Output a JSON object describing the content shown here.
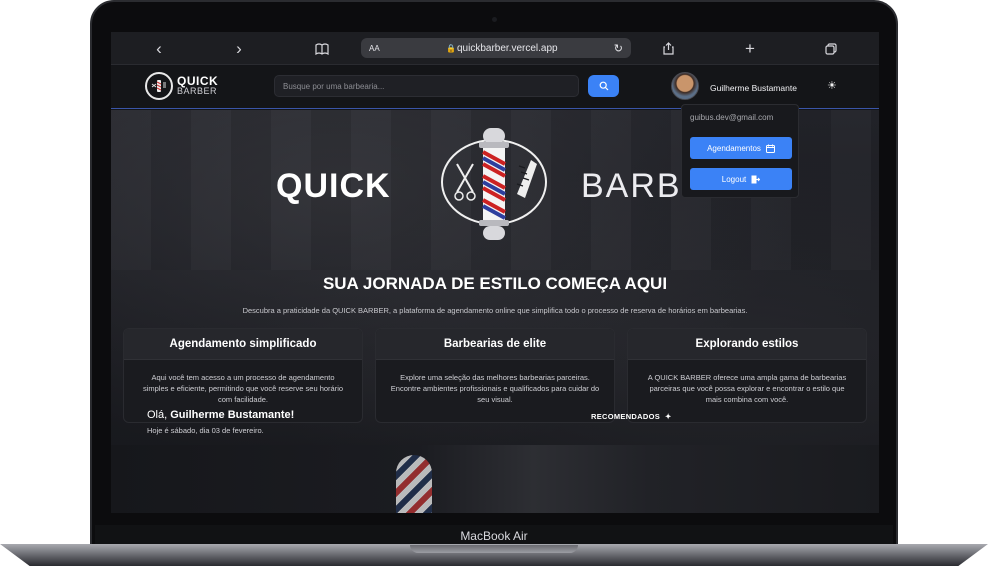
{
  "device": {
    "label": "MacBook Air"
  },
  "browser": {
    "url": "quickbarber.vercel.app",
    "text_size_label": "AA"
  },
  "header": {
    "logo": {
      "line1": "QUICK",
      "line2": "BARBER"
    },
    "search": {
      "placeholder": "Busque por uma barbearia..."
    },
    "user": {
      "name": "Guilherme Bustamante"
    }
  },
  "dropdown": {
    "email": "guibus.dev@gmail.com",
    "appointments_label": "Agendamentos",
    "logout_label": "Logout"
  },
  "hero": {
    "brand_left": "QUICK",
    "brand_right": "BARBER",
    "title": "SUA JORNADA DE ESTILO COMEÇA AQUI",
    "subtitle": "Descubra a praticidade da QUICK BARBER, a plataforma de agendamento online que simplifica todo o processo de reserva de horários em barbearias.",
    "features": [
      {
        "title": "Agendamento simplificado",
        "text": "Aqui você tem acesso a um processo de agendamento simples e eficiente, permitindo que você reserve seu horário com facilidade."
      },
      {
        "title": "Barbearias de elite",
        "text": "Explore uma seleção das melhores barbearias parceiras. Encontre ambientes profissionais e qualificados para cuidar do seu visual."
      },
      {
        "title": "Explorando estilos",
        "text": "A QUICK BARBER oferece uma ampla gama de barbearias parceiras que você possa explorar e encontrar o estilo que mais combina com você."
      }
    ]
  },
  "welcome": {
    "greeting_prefix": "Olá, ",
    "user_name": "Guilherme Bustamante!",
    "date": "Hoje é sábado, dia 03 de fevereiro.",
    "recommended_label": "RECOMENDADOS"
  },
  "colors": {
    "accent": "#3b82f6",
    "background": "#131418"
  }
}
